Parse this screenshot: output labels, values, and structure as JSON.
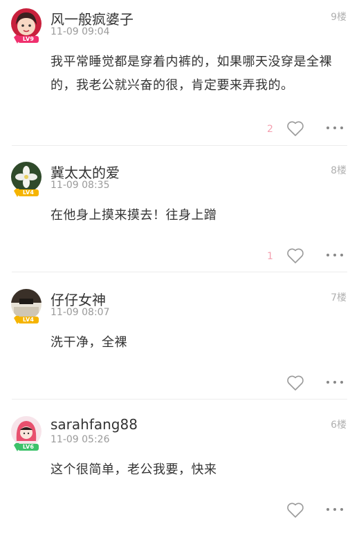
{
  "comments": [
    {
      "username": "风一般疯婆子",
      "time": "11-09 09:04",
      "floor": "9楼",
      "level": "LV9",
      "level_color": "#f0306e",
      "text": "我平常睡觉都是穿着内裤的，如果哪天没穿是全裸的，我老公就兴奋的很，肯定要来弄我的。",
      "likes": "2",
      "avatar": "cartoon-girl-avatar"
    },
    {
      "username": "冀太太的爱",
      "time": "11-09 08:35",
      "floor": "8楼",
      "level": "LV4",
      "level_color": "#f5b400",
      "text": "在他身上摸来摸去！往身上蹭",
      "likes": "1",
      "avatar": "white-flower-avatar"
    },
    {
      "username": "仔仔女神",
      "time": "11-09 08:07",
      "floor": "7楼",
      "level": "LV4",
      "level_color": "#f5b400",
      "text": "洗干净，全裸",
      "likes": "",
      "avatar": "dark-photo-avatar"
    },
    {
      "username": "sarahfang88",
      "time": "11-09 05:26",
      "floor": "6楼",
      "level": "LV6",
      "level_color": "#3cc26a",
      "text": "这个很简单，老公我要，快来",
      "likes": "",
      "avatar": "pink-hood-avatar"
    }
  ]
}
